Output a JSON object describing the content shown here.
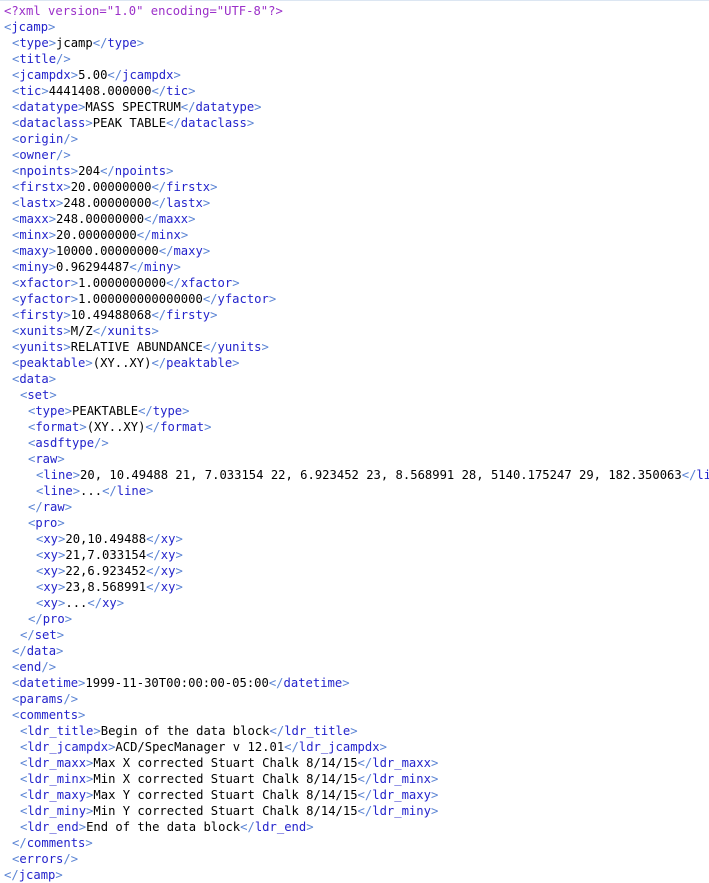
{
  "document": {
    "kind": "xml-source-view",
    "root_element": "jcamp",
    "background_color": "#ffffff",
    "colors": {
      "declaration": "#9b30c9",
      "bracket": "#5b84d4",
      "tag_name": "#2424cc",
      "text_node": "#000000",
      "top_rule": "#dce6f2"
    },
    "declaration": "<?xml version=\"1.0\" encoding=\"UTF-8\"?>"
  },
  "lines": [
    {
      "indent": 0,
      "type": "declaration",
      "text": "<?xml version=\"1.0\" encoding=\"UTF-8\"?>"
    },
    {
      "indent": 0,
      "type": "open",
      "tag": "jcamp"
    },
    {
      "indent": 1,
      "type": "leaf",
      "tag": "type",
      "value": "jcamp"
    },
    {
      "indent": 1,
      "type": "empty",
      "tag": "title"
    },
    {
      "indent": 1,
      "type": "leaf",
      "tag": "jcampdx",
      "value": "5.00"
    },
    {
      "indent": 1,
      "type": "leaf",
      "tag": "tic",
      "value": "4441408.000000"
    },
    {
      "indent": 1,
      "type": "leaf",
      "tag": "datatype",
      "value": "MASS SPECTRUM"
    },
    {
      "indent": 1,
      "type": "leaf",
      "tag": "dataclass",
      "value": "PEAK TABLE"
    },
    {
      "indent": 1,
      "type": "empty",
      "tag": "origin"
    },
    {
      "indent": 1,
      "type": "empty",
      "tag": "owner"
    },
    {
      "indent": 1,
      "type": "leaf",
      "tag": "npoints",
      "value": "204"
    },
    {
      "indent": 1,
      "type": "leaf",
      "tag": "firstx",
      "value": "20.00000000"
    },
    {
      "indent": 1,
      "type": "leaf",
      "tag": "lastx",
      "value": "248.00000000"
    },
    {
      "indent": 1,
      "type": "leaf",
      "tag": "maxx",
      "value": "248.00000000"
    },
    {
      "indent": 1,
      "type": "leaf",
      "tag": "minx",
      "value": "20.00000000"
    },
    {
      "indent": 1,
      "type": "leaf",
      "tag": "maxy",
      "value": "10000.00000000"
    },
    {
      "indent": 1,
      "type": "leaf",
      "tag": "miny",
      "value": "0.96294487"
    },
    {
      "indent": 1,
      "type": "leaf",
      "tag": "xfactor",
      "value": "1.0000000000"
    },
    {
      "indent": 1,
      "type": "leaf",
      "tag": "yfactor",
      "value": "1.000000000000000"
    },
    {
      "indent": 1,
      "type": "leaf",
      "tag": "firsty",
      "value": "10.49488068"
    },
    {
      "indent": 1,
      "type": "leaf",
      "tag": "xunits",
      "value": "M/Z"
    },
    {
      "indent": 1,
      "type": "leaf",
      "tag": "yunits",
      "value": "RELATIVE ABUNDANCE"
    },
    {
      "indent": 1,
      "type": "leaf",
      "tag": "peaktable",
      "value": "(XY..XY)"
    },
    {
      "indent": 1,
      "type": "open",
      "tag": "data"
    },
    {
      "indent": 2,
      "type": "open",
      "tag": "set"
    },
    {
      "indent": 3,
      "type": "leaf",
      "tag": "type",
      "value": "PEAKTABLE"
    },
    {
      "indent": 3,
      "type": "leaf",
      "tag": "format",
      "value": "(XY..XY)"
    },
    {
      "indent": 3,
      "type": "empty",
      "tag": "asdftype"
    },
    {
      "indent": 3,
      "type": "open",
      "tag": "raw"
    },
    {
      "indent": 4,
      "type": "leaf",
      "tag": "line",
      "value": "20, 10.49488 21, 7.033154 22, 6.923452 23, 8.568991 28, 5140.175247 29, 182.350063"
    },
    {
      "indent": 4,
      "type": "leaf",
      "tag": "line",
      "value": "..."
    },
    {
      "indent": 3,
      "type": "close",
      "tag": "raw"
    },
    {
      "indent": 3,
      "type": "open",
      "tag": "pro"
    },
    {
      "indent": 4,
      "type": "leaf",
      "tag": "xy",
      "value": "20,10.49488"
    },
    {
      "indent": 4,
      "type": "leaf",
      "tag": "xy",
      "value": "21,7.033154"
    },
    {
      "indent": 4,
      "type": "leaf",
      "tag": "xy",
      "value": "22,6.923452"
    },
    {
      "indent": 4,
      "type": "leaf",
      "tag": "xy",
      "value": "23,8.568991"
    },
    {
      "indent": 4,
      "type": "leaf",
      "tag": "xy",
      "value": "..."
    },
    {
      "indent": 3,
      "type": "close",
      "tag": "pro"
    },
    {
      "indent": 2,
      "type": "close",
      "tag": "set"
    },
    {
      "indent": 1,
      "type": "close",
      "tag": "data"
    },
    {
      "indent": 1,
      "type": "empty",
      "tag": "end"
    },
    {
      "indent": 1,
      "type": "leaf",
      "tag": "datetime",
      "value": "1999-11-30T00:00:00-05:00"
    },
    {
      "indent": 1,
      "type": "empty",
      "tag": "params"
    },
    {
      "indent": 1,
      "type": "open",
      "tag": "comments"
    },
    {
      "indent": 2,
      "type": "leaf",
      "tag": "ldr_title",
      "value": "Begin of the data block"
    },
    {
      "indent": 2,
      "type": "leaf",
      "tag": "ldr_jcampdx",
      "value": "ACD/SpecManager v 12.01"
    },
    {
      "indent": 2,
      "type": "leaf",
      "tag": "ldr_maxx",
      "value": "Max X corrected Stuart Chalk 8/14/15"
    },
    {
      "indent": 2,
      "type": "leaf",
      "tag": "ldr_minx",
      "value": "Min X corrected Stuart Chalk 8/14/15"
    },
    {
      "indent": 2,
      "type": "leaf",
      "tag": "ldr_maxy",
      "value": "Max Y corrected Stuart Chalk 8/14/15"
    },
    {
      "indent": 2,
      "type": "leaf",
      "tag": "ldr_miny",
      "value": "Min Y corrected Stuart Chalk 8/14/15"
    },
    {
      "indent": 2,
      "type": "leaf",
      "tag": "ldr_end",
      "value": "End of the data block"
    },
    {
      "indent": 1,
      "type": "close",
      "tag": "comments"
    },
    {
      "indent": 1,
      "type": "empty",
      "tag": "errors"
    },
    {
      "indent": 0,
      "type": "close",
      "tag": "jcamp"
    }
  ]
}
